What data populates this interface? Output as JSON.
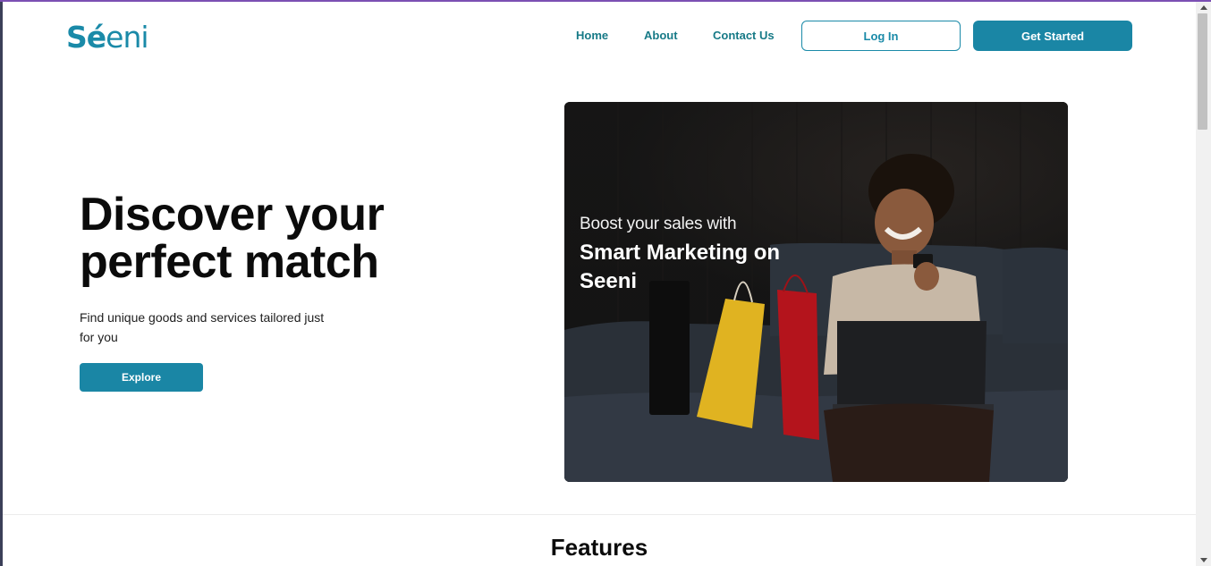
{
  "header": {
    "logo": {
      "bold": "Sé",
      "light": "eni"
    },
    "nav": {
      "home": "Home",
      "about": "About",
      "contact": "Contact Us"
    },
    "login_label": "Log In",
    "get_started_label": "Get Started"
  },
  "hero": {
    "title": "Discover your perfect match",
    "subtitle": "Find unique goods and services tailored just for you",
    "explore_label": "Explore",
    "promo": {
      "line1": "Boost your sales with",
      "line2": "Smart Marketing on Seeni"
    }
  },
  "features": {
    "title": "Features"
  },
  "colors": {
    "brand": "#1a86a5",
    "nav_text": "#177a87",
    "top_strip": "#7b4fb3"
  }
}
